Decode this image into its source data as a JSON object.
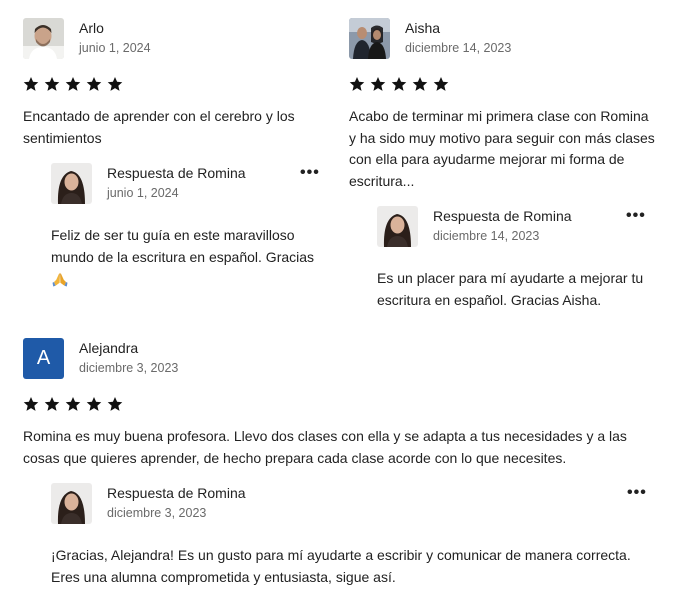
{
  "reviews": [
    {
      "author": "Arlo",
      "date": "junio 1, 2024",
      "rating": 5,
      "text": "Encantado de aprender con el cerebro y los sentimientos",
      "reply": {
        "title": "Respuesta de Romina",
        "date": "junio 1, 2024",
        "more": "•••",
        "text": "Feliz de ser tu guía en este maravilloso mundo de la escritura en español. Gracias",
        "emoji": "folded-hands-icon"
      }
    },
    {
      "author": "Aisha",
      "date": "diciembre 14, 2023",
      "rating": 5,
      "text": "Acabo de terminar mi primera clase con Romina y ha sido muy motivo para seguir con más clases con ella para ayudarme mejorar mi forma de escritura...",
      "reply": {
        "title": "Respuesta de Romina",
        "date": "diciembre 14, 2023",
        "more": "•••",
        "text": "Es un placer para mí ayudarte a mejorar tu escritura en español. Gracias Aisha."
      }
    },
    {
      "author": "Alejandra",
      "initial": "A",
      "date": "diciembre 3, 2023",
      "rating": 5,
      "text": "Romina es muy buena profesora. Llevo dos clases con ella y se adapta a tus necesidades y a las cosas que quieres aprender, de hecho prepara cada clase acorde con lo que necesites.",
      "reply": {
        "title": "Respuesta de Romina",
        "date": "diciembre 3, 2023",
        "more": "•••",
        "text": "¡Gracias, Alejandra! Es un gusto para mí ayudarte a escribir y comunicar de manera correcta. Eres una alumna comprometida y entusiasta, sigue así."
      }
    }
  ],
  "colors": {
    "text": "#222222",
    "muted": "#6a6a6a",
    "initial_avatar": "#1f5aa8"
  }
}
